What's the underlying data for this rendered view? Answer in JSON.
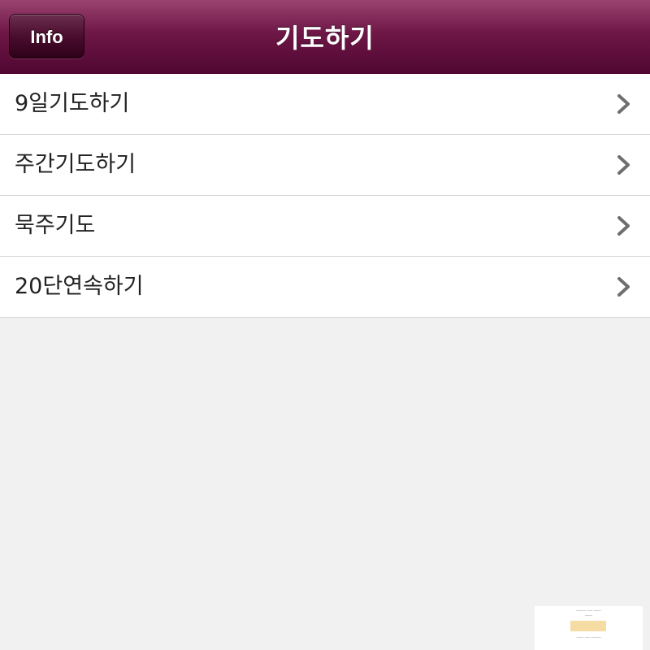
{
  "header": {
    "title": "기도하기",
    "info_label": "Info"
  },
  "menu": {
    "items": [
      {
        "label": "9일기도하기"
      },
      {
        "label": "주간기도하기"
      },
      {
        "label": "묵주기도"
      },
      {
        "label": "20단연속하기"
      }
    ]
  },
  "colors": {
    "navbar": "#6e1747",
    "background": "#f1f1f1",
    "row_background": "#ffffff",
    "chevron": "#6e6e6e"
  },
  "icons": {
    "row_disclosure": "chevron-right-icon"
  }
}
